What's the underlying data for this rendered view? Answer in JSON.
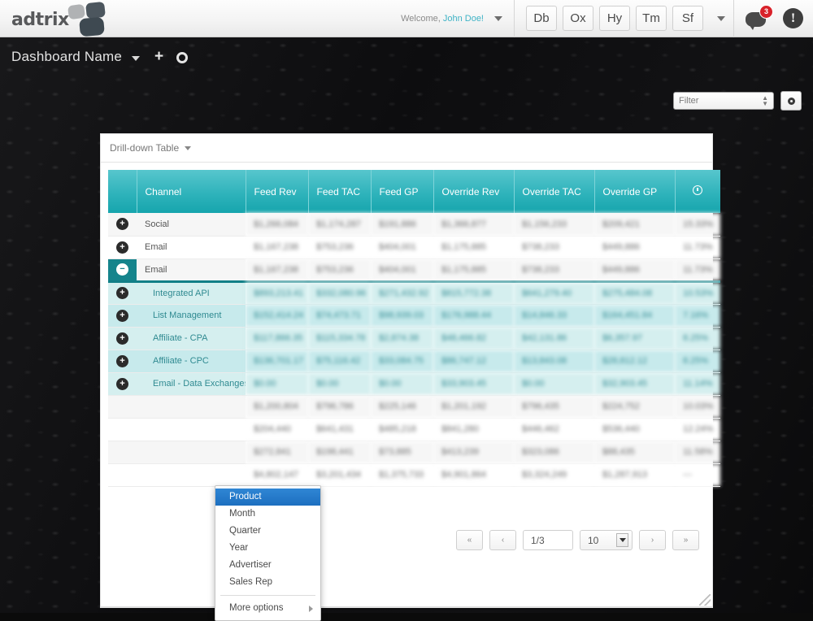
{
  "topbar": {
    "logo_text": "adtrix",
    "welcome_prefix": "Welcome,",
    "user_name": "John Doe!",
    "app_buttons": [
      {
        "label": "Db",
        "name": "app-button-db"
      },
      {
        "label": "Ox",
        "name": "app-button-ox"
      },
      {
        "label": "Hy",
        "name": "app-button-hy"
      },
      {
        "label": "Tm",
        "name": "app-button-tm"
      },
      {
        "label": "Sf",
        "name": "app-button-sf"
      }
    ],
    "notification_count": "3",
    "alert_glyph": "!"
  },
  "dashboard_bar": {
    "title": "Dashboard Name",
    "add_glyph": "+",
    "filter_placeholder": "Filter"
  },
  "panel": {
    "title": "Drill-down Table"
  },
  "table": {
    "columns": [
      {
        "key": "expand",
        "label": ""
      },
      {
        "key": "channel",
        "label": "Channel"
      },
      {
        "key": "feed_rev",
        "label": "Feed Rev"
      },
      {
        "key": "feed_tac",
        "label": "Feed TAC"
      },
      {
        "key": "feed_gp",
        "label": "Feed GP"
      },
      {
        "key": "override_rev",
        "label": "Override Rev"
      },
      {
        "key": "override_tac",
        "label": "Override TAC"
      },
      {
        "key": "override_gp",
        "label": "Override GP"
      },
      {
        "key": "clock",
        "label": ""
      }
    ],
    "rows": [
      {
        "label": "Social",
        "type": "parent",
        "state": "collapsed",
        "stripe": "alt",
        "values": [
          "$1,266,084",
          "$1,174,287",
          "$191,886",
          "$1,366,877",
          "$1,156,233",
          "$209,421",
          "15.33%"
        ]
      },
      {
        "label": "Email",
        "type": "parent",
        "state": "collapsed",
        "stripe": "plain",
        "values": [
          "$1,167,238",
          "$753,236",
          "$404,001",
          "$1,175,885",
          "$738,233",
          "$449,886",
          "11.73%"
        ]
      },
      {
        "label": "Email",
        "type": "parent",
        "state": "expanded",
        "stripe": "alt",
        "values": [
          "$1,167,238",
          "$753,236",
          "$404,001",
          "$1,175,885",
          "$738,233",
          "$449,886",
          "11.73%"
        ]
      },
      {
        "label": "Integrated API",
        "type": "child",
        "state": "collapsed",
        "stripe": "child-a",
        "values": [
          "$893,213.41",
          "$332,080.96",
          "$271,432.92",
          "$815,772.38",
          "$641,279.40",
          "$275,484.08",
          "10.53%"
        ]
      },
      {
        "label": "List Management",
        "type": "child",
        "state": "collapsed",
        "stripe": "child-b",
        "values": [
          "$152,414.24",
          "$74,473.71",
          "$98,939.03",
          "$176,988.44",
          "$14,846.33",
          "$164,451.84",
          "7.16%"
        ]
      },
      {
        "label": "Affiliate - CPA",
        "type": "child",
        "state": "collapsed",
        "stripe": "child-a",
        "values": [
          "$117,866.35",
          "$115,334.78",
          "$2,874.38",
          "$48,466.82",
          "$42,131.86",
          "$6,357.97",
          "8.25%"
        ]
      },
      {
        "label": "Affiliate - CPC",
        "type": "child",
        "state": "collapsed",
        "stripe": "child-b",
        "values": [
          "$136,701.17",
          "$75,116.42",
          "$33,084.75",
          "$86,747.12",
          "$13,843.08",
          "$28,812.12",
          "8.25%"
        ]
      },
      {
        "label": "Email - Data Exchanges",
        "type": "child",
        "state": "collapsed",
        "stripe": "child-a",
        "values": [
          "$0.00",
          "$0.00",
          "$0.00",
          "$33,903.45",
          "$0.00",
          "$32,903.45",
          "11.14%"
        ]
      },
      {
        "label": "",
        "type": "hidden",
        "state": "collapsed",
        "stripe": "alt",
        "values": [
          "$1,200,804",
          "$796,786",
          "$225,146",
          "$1,201,192",
          "$796,435",
          "$224,752",
          "10.03%"
        ]
      },
      {
        "label": "",
        "type": "hidden",
        "state": "collapsed",
        "stripe": "plain",
        "values": [
          "$204,440",
          "$641,431",
          "$485,218",
          "$841,280",
          "$446,462",
          "$536,440",
          "12.24%"
        ]
      },
      {
        "label": "",
        "type": "hidden",
        "state": "collapsed",
        "stripe": "alt",
        "values": [
          "$272,841",
          "$198,441",
          "$73,885",
          "$413,239",
          "$323,086",
          "$88,435",
          "11.58%"
        ]
      },
      {
        "label": "",
        "type": "hidden",
        "state": "collapsed",
        "stripe": "plain",
        "values": [
          "$4,802,147",
          "$3,201,434",
          "$1,375,733",
          "$4,901,864",
          "$3,324,249",
          "$1,287,913",
          "---"
        ]
      }
    ]
  },
  "dropdown_menu": {
    "items": [
      {
        "label": "Product",
        "active": true
      },
      {
        "label": "Month",
        "active": false
      },
      {
        "label": "Quarter",
        "active": false
      },
      {
        "label": "Year",
        "active": false
      },
      {
        "label": "Advertiser",
        "active": false
      },
      {
        "label": "Sales Rep",
        "active": false
      }
    ],
    "more_label": "More options"
  },
  "pagination": {
    "first_label": "«",
    "prev_label": "‹",
    "page_value": "1/3",
    "page_size": "10",
    "next_label": "›",
    "last_label": "»"
  },
  "colors": {
    "teal_header_top": "#57c6cd",
    "teal_header_bottom": "#16a5ad",
    "teal_selected": "#15848c",
    "child_row": "#d5efef",
    "accent_link": "#3fb3c6",
    "menu_active": "#2f86d4",
    "badge_red": "#d8222a"
  }
}
